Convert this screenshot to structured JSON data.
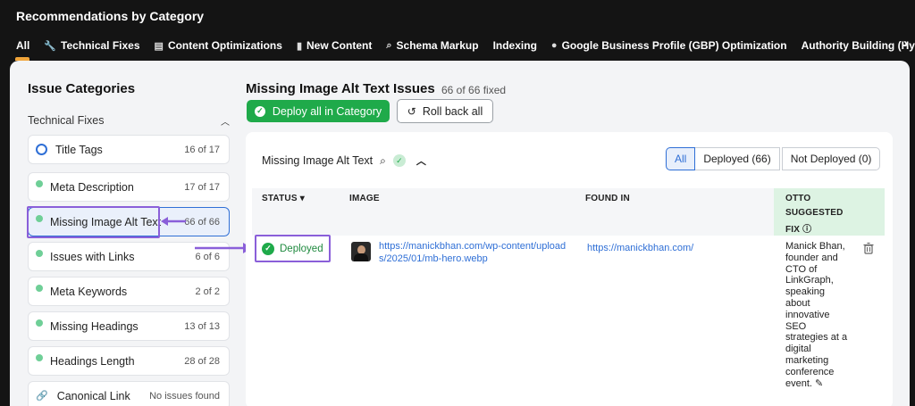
{
  "header": {
    "title": "Recommendations by Category",
    "tabs": [
      {
        "label": "All",
        "icon": ""
      },
      {
        "label": "Technical Fixes",
        "icon": "wrench-icon"
      },
      {
        "label": "Content Optimizations",
        "icon": "document-edit-icon"
      },
      {
        "label": "New Content",
        "icon": "new-document-icon"
      },
      {
        "label": "Schema Markup",
        "icon": "search-icon"
      },
      {
        "label": "Indexing",
        "icon": ""
      },
      {
        "label": "Google Business Profile (GBP) Optimization",
        "icon": "location-pin-icon"
      },
      {
        "label": "Authority Building (Hype",
        "icon": ""
      }
    ],
    "accent": "#f0a53a"
  },
  "sidebar": {
    "title": "Issue Categories",
    "group_label": "Technical Fixes",
    "items": [
      {
        "label": "Title Tags",
        "count": "16 of 17"
      },
      {
        "label": "Meta Description",
        "count": "17 of 17"
      },
      {
        "label": "Missing Image Alt Text",
        "count": "66 of 66"
      },
      {
        "label": "Issues with Links",
        "count": "6 of 6"
      },
      {
        "label": "Meta Keywords",
        "count": "2 of 2"
      },
      {
        "label": "Missing Headings",
        "count": "13 of 13"
      },
      {
        "label": "Headings Length",
        "count": "28 of 28"
      },
      {
        "label": "Canonical Link",
        "count": "No issues found"
      }
    ]
  },
  "main": {
    "title": "Missing Image Alt Text Issues",
    "fixed_count": "66 of 66 fixed",
    "deploy_label": "Deploy all in Category",
    "rollback_label": "Roll back all",
    "panel_title": "Missing Image Alt Text",
    "filters": [
      "All",
      "Deployed (66)",
      "Not Deployed (0)"
    ],
    "columns": {
      "status": "STATUS",
      "image": "IMAGE",
      "found_in": "FOUND IN",
      "otto_1": "OTTO",
      "otto_2": "SUGGESTED",
      "otto_3": "FIX"
    },
    "row": {
      "status": "Deployed",
      "image_url": "https://manickbhan.com/wp-content/uploads/2025/01/mb-hero.webp",
      "found_in": "https://manickbhan.com/",
      "suggested_fix": "Manick Bhan, founder and CTO of LinkGraph, speaking about innovative SEO strategies at a digital marketing conference event."
    },
    "colors": {
      "success": "#1faa4a",
      "link": "#2f6fd6",
      "highlight": "#8a5fd9"
    }
  }
}
